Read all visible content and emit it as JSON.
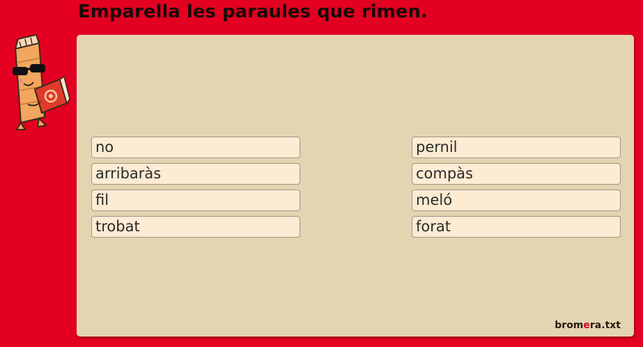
{
  "instruction": "Emparella les paraules que rimen.",
  "left_words": [
    "no",
    "arribaràs",
    "fil",
    "trobat"
  ],
  "right_words": [
    "pernil",
    "compàs",
    "meló",
    "forat"
  ],
  "brand": {
    "part1": "brom",
    "accent": "e",
    "part2": "ra.txt"
  },
  "mascot_icon": "pencil-reading-book-icon",
  "colors": {
    "background": "#e30020",
    "panel": "#e3d5b2",
    "word_box": "#fdebd3",
    "brand_accent": "#e30020"
  }
}
